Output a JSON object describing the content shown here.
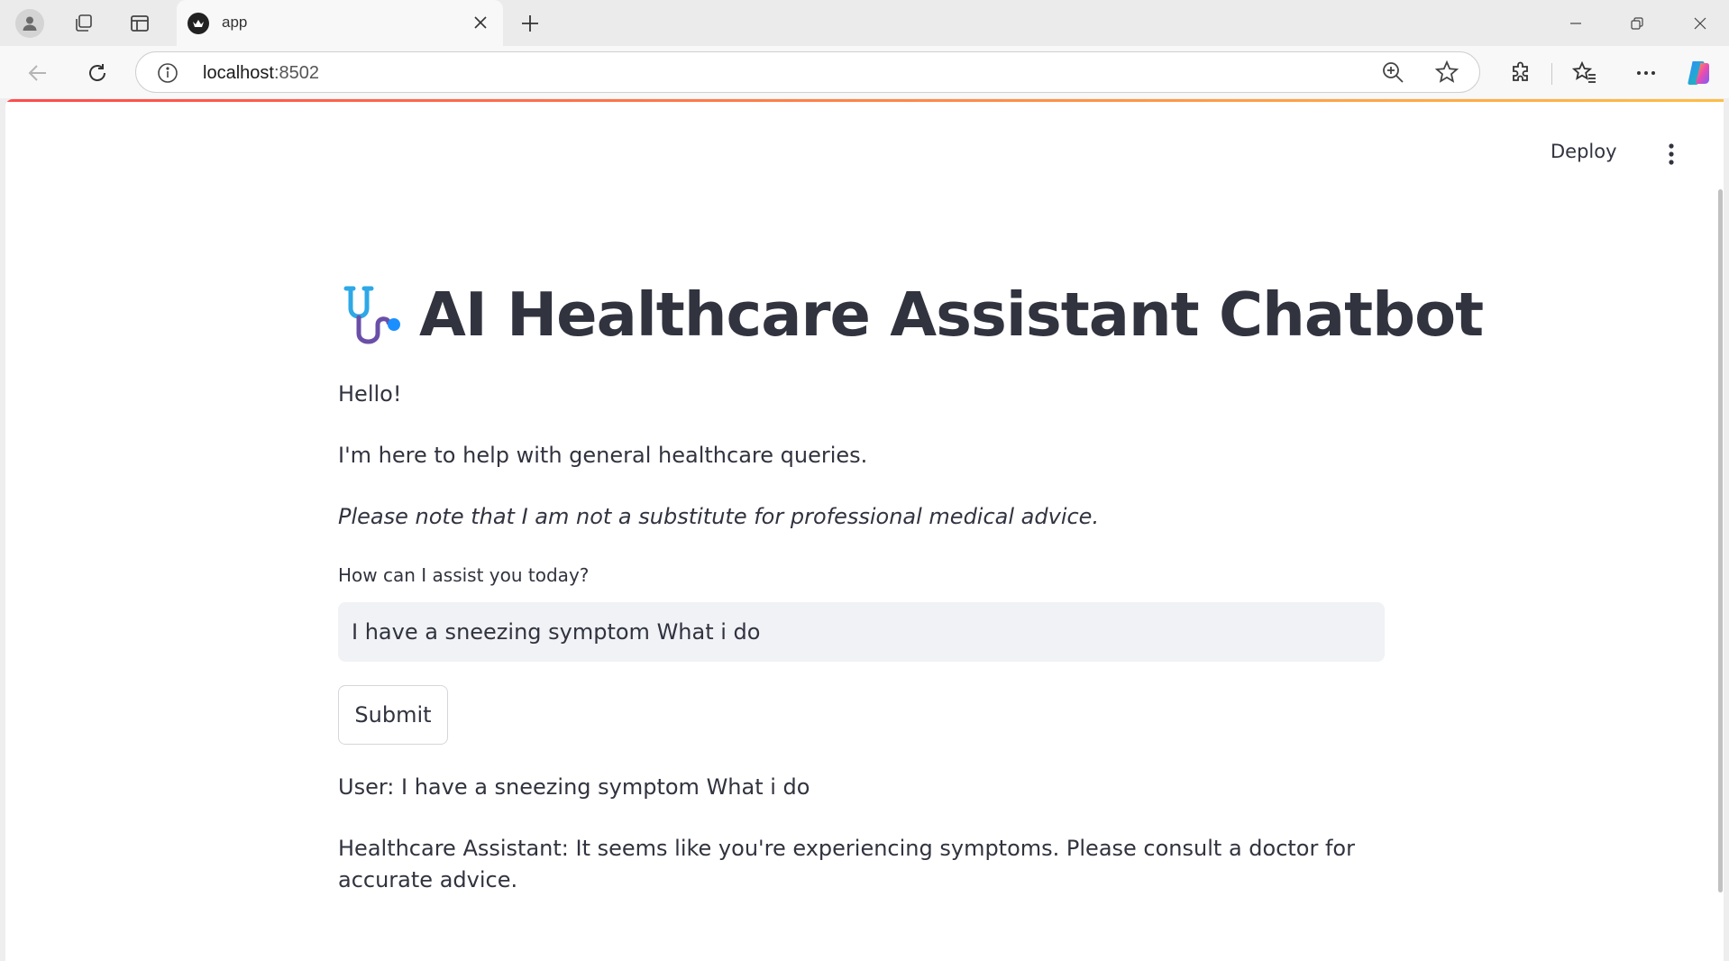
{
  "browser": {
    "tab_title": "app",
    "url_host": "localhost",
    "url_port": ":8502"
  },
  "header": {
    "deploy_label": "Deploy"
  },
  "main": {
    "title": "AI Healthcare Assistant Chatbot",
    "greeting": "Hello!",
    "intro": "I'm here to help with general healthcare queries.",
    "disclaimer": "Please note that I am not a substitute for professional medical advice.",
    "input_label": "How can I assist you today?",
    "input_value": "I have a sneezing symptom What i do",
    "submit_label": "Submit",
    "user_message": "User: I have a sneezing symptom What i do",
    "assistant_message": "Healthcare Assistant: It seems like you're experiencing symptoms. Please consult a doctor for accurate advice."
  },
  "colors": {
    "text": "#31333f",
    "input_bg": "#f0f2f6",
    "decoration_start": "#ff4b4b",
    "decoration_end": "#ffbd45"
  },
  "icons": [
    "profile-icon",
    "workspaces-icon",
    "vertical-tabs-icon",
    "new-tab-icon",
    "back-icon",
    "reload-icon",
    "info-icon",
    "zoom-icon",
    "favorite-star-icon",
    "extensions-icon",
    "favorites-icon",
    "more-icon",
    "copilot-icon",
    "stethoscope-icon",
    "kebab-menu-icon"
  ]
}
